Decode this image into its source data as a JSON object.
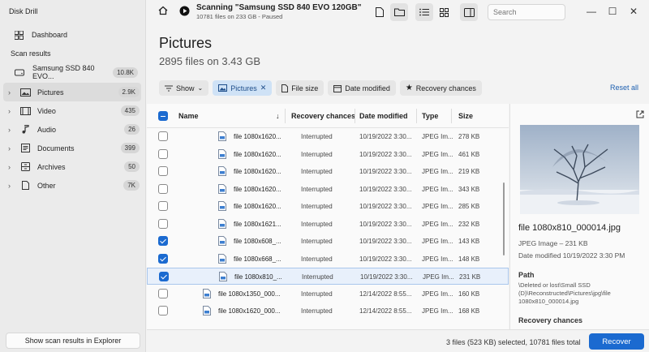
{
  "app": {
    "title": "Disk Drill"
  },
  "sidebar": {
    "dashboard": "Dashboard",
    "scan_results_heading": "Scan results",
    "drive": {
      "label": "Samsung SSD 840 EVO...",
      "count": "10.8K"
    },
    "categories": [
      {
        "label": "Pictures",
        "count": "2.9K",
        "icon": "image-icon",
        "active": true
      },
      {
        "label": "Video",
        "count": "435",
        "icon": "film-icon"
      },
      {
        "label": "Audio",
        "count": "26",
        "icon": "music-note-icon"
      },
      {
        "label": "Documents",
        "count": "399",
        "icon": "document-icon"
      },
      {
        "label": "Archives",
        "count": "50",
        "icon": "archive-icon"
      },
      {
        "label": "Other",
        "count": "7K",
        "icon": "file-icon"
      }
    ],
    "footer_button": "Show scan results in Explorer"
  },
  "topbar": {
    "scan_title": "Scanning \"Samsung SSD 840 EVO 120GB\"",
    "scan_subtitle": "10781 files on 233 GB - Paused",
    "search_placeholder": "Search"
  },
  "page": {
    "title": "Pictures",
    "subtitle": "2895 files on 3.43 GB"
  },
  "filters": {
    "show": "Show",
    "pictures": "Pictures",
    "file_size": "File size",
    "date_modified": "Date modified",
    "recovery_chances": "Recovery chances",
    "reset": "Reset all"
  },
  "table": {
    "headers": {
      "name": "Name",
      "recovery": "Recovery chances",
      "date": "Date modified",
      "type": "Type",
      "size": "Size"
    },
    "rows": [
      {
        "name": "file 1080x1620...",
        "recovery": "Interrupted",
        "date": "10/19/2022 3:30...",
        "type": "JPEG Im...",
        "size": "278 KB",
        "checked": false,
        "indent": 1
      },
      {
        "name": "file 1080x1620...",
        "recovery": "Interrupted",
        "date": "10/19/2022 3:30...",
        "type": "JPEG Im...",
        "size": "461 KB",
        "checked": false,
        "indent": 1
      },
      {
        "name": "file 1080x1620...",
        "recovery": "Interrupted",
        "date": "10/19/2022 3:30...",
        "type": "JPEG Im...",
        "size": "219 KB",
        "checked": false,
        "indent": 1
      },
      {
        "name": "file 1080x1620...",
        "recovery": "Interrupted",
        "date": "10/19/2022 3:30...",
        "type": "JPEG Im...",
        "size": "343 KB",
        "checked": false,
        "indent": 1
      },
      {
        "name": "file 1080x1620...",
        "recovery": "Interrupted",
        "date": "10/19/2022 3:30...",
        "type": "JPEG Im...",
        "size": "285 KB",
        "checked": false,
        "indent": 1
      },
      {
        "name": "file 1080x1621...",
        "recovery": "Interrupted",
        "date": "10/19/2022 3:30...",
        "type": "JPEG Im...",
        "size": "232 KB",
        "checked": false,
        "indent": 1
      },
      {
        "name": "file 1080x608_...",
        "recovery": "Interrupted",
        "date": "10/19/2022 3:30...",
        "type": "JPEG Im...",
        "size": "143 KB",
        "checked": true,
        "indent": 1
      },
      {
        "name": "file 1080x668_...",
        "recovery": "Interrupted",
        "date": "10/19/2022 3:30...",
        "type": "JPEG Im...",
        "size": "148 KB",
        "checked": true,
        "indent": 1
      },
      {
        "name": "file 1080x810_...",
        "recovery": "Interrupted",
        "date": "10/19/2022 3:30...",
        "type": "JPEG Im...",
        "size": "231 KB",
        "checked": true,
        "indent": 1,
        "highlight": true
      },
      {
        "name": "file 1080x1350_000...",
        "recovery": "Interrupted",
        "date": "12/14/2022 8:55...",
        "type": "JPEG Im...",
        "size": "160 KB",
        "checked": false,
        "indent": 0
      },
      {
        "name": "file 1080x1620_000...",
        "recovery": "Interrupted",
        "date": "12/14/2022 8:55...",
        "type": "JPEG Im...",
        "size": "168 KB",
        "checked": false,
        "indent": 0
      }
    ]
  },
  "preview": {
    "file_name": "file 1080x810_000014.jpg",
    "file_type": "JPEG Image – 231 KB",
    "date_modified": "Date modified 10/19/2022 3:30 PM",
    "path_heading": "Path",
    "path": "\\Deleted or lost\\Small SSD (D)\\Reconstructed\\Pictures\\jpg\\file 1080x810_000014.jpg",
    "recovery_heading": "Recovery chances"
  },
  "footer": {
    "selection": "3 files (523 KB) selected, 10781 files total",
    "recover": "Recover"
  },
  "colors": {
    "accent": "#1b6ad0",
    "selected_chip": "#cfe2f6"
  }
}
